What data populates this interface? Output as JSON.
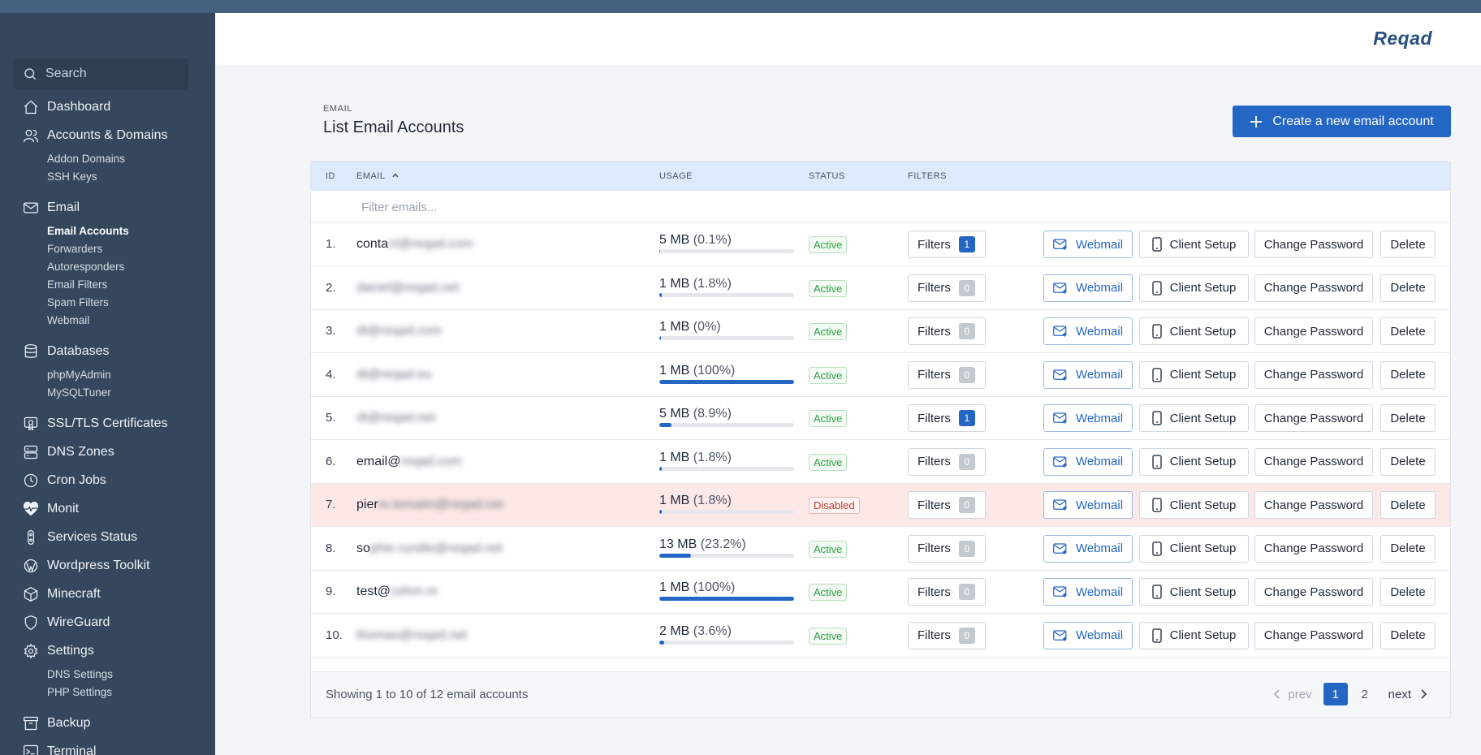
{
  "sidebar": {
    "search_placeholder": "Search",
    "items": [
      {
        "label": "Dashboard",
        "icon": "home-icon"
      },
      {
        "label": "Accounts & Domains",
        "icon": "users-icon",
        "sub": [
          "Addon Domains",
          "SSH Keys"
        ]
      },
      {
        "label": "Email",
        "icon": "mail-icon",
        "sub": [
          "Email Accounts",
          "Forwarders",
          "Autoresponders",
          "Email Filters",
          "Spam Filters",
          "Webmail"
        ],
        "active_sub": "Email Accounts"
      },
      {
        "label": "Databases",
        "icon": "database-icon",
        "sub": [
          "phpMyAdmin",
          "MySQLTuner"
        ]
      },
      {
        "label": "SSL/TLS Certificates",
        "icon": "certificate-icon"
      },
      {
        "label": "DNS Zones",
        "icon": "server-icon"
      },
      {
        "label": "Cron Jobs",
        "icon": "clock-icon"
      },
      {
        "label": "Monit",
        "icon": "heartbeat-icon"
      },
      {
        "label": "Services Status",
        "icon": "toggle-icon"
      },
      {
        "label": "Wordpress Toolkit",
        "icon": "wordpress-icon"
      },
      {
        "label": "Minecraft",
        "icon": "cube-icon"
      },
      {
        "label": "WireGuard",
        "icon": "shield-icon"
      },
      {
        "label": "Settings",
        "icon": "gear-icon",
        "sub": [
          "DNS Settings",
          "PHP Settings"
        ]
      },
      {
        "label": "Backup",
        "icon": "archive-icon"
      },
      {
        "label": "Terminal",
        "icon": "terminal-icon"
      }
    ]
  },
  "header": {
    "logo": "Reqad"
  },
  "page": {
    "breadcrumb": "EMAIL",
    "title": "List Email Accounts",
    "create_button": "Create a new email account"
  },
  "table": {
    "columns": {
      "id": "ID",
      "email": "EMAIL",
      "usage": "USAGE",
      "status": "STATUS",
      "filters": "FILTERS"
    },
    "filter_placeholder": "Filter emails...",
    "filters_label": "Filters",
    "actions": {
      "webmail": "Webmail",
      "client": "Client Setup",
      "password": "Change Password",
      "delete": "Delete"
    },
    "rows": [
      {
        "id": "1.",
        "email_visible": "conta",
        "email_blurred": "ct@reqad.com",
        "usage": "5 MB",
        "pct": "(0.1%)",
        "fill": 0.1,
        "status": "Active",
        "filters": "1"
      },
      {
        "id": "2.",
        "email_visible": "",
        "email_blurred": "daniel@reqad.net",
        "usage": "1 MB",
        "pct": "(1.8%)",
        "fill": 1.8,
        "status": "Active",
        "filters": "0"
      },
      {
        "id": "3.",
        "email_visible": "",
        "email_blurred": "dt@reqad.com",
        "usage": "1 MB",
        "pct": "(0%)",
        "fill": 0,
        "status": "Active",
        "filters": "0"
      },
      {
        "id": "4.",
        "email_visible": "",
        "email_blurred": "dt@reqad.eu",
        "usage": "1 MB",
        "pct": "(100%)",
        "fill": 100,
        "status": "Active",
        "filters": "0"
      },
      {
        "id": "5.",
        "email_visible": "",
        "email_blurred": "dt@reqad.net",
        "usage": "5 MB",
        "pct": "(8.9%)",
        "fill": 8.9,
        "status": "Active",
        "filters": "1"
      },
      {
        "id": "6.",
        "email_visible": "email@",
        "email_blurred": "reqad.com",
        "usage": "1 MB",
        "pct": "(1.8%)",
        "fill": 1.8,
        "status": "Active",
        "filters": "0"
      },
      {
        "id": "7.",
        "email_visible": "pier",
        "email_blurred": "re.lematin@reqad.net",
        "usage": "1 MB",
        "pct": "(1.8%)",
        "fill": 1.8,
        "status": "Disabled",
        "filters": "0"
      },
      {
        "id": "8.",
        "email_visible": "so",
        "email_blurred": "phie.rundle@reqad.net",
        "usage": "13 MB",
        "pct": "(23.2%)",
        "fill": 23.2,
        "status": "Active",
        "filters": "0"
      },
      {
        "id": "9.",
        "email_visible": "test@",
        "email_blurred": "cohm.re",
        "usage": "1 MB",
        "pct": "(100%)",
        "fill": 100,
        "status": "Active",
        "filters": "0"
      },
      {
        "id": "10.",
        "email_visible": "",
        "email_blurred": "thomas@reqad.net",
        "usage": "2 MB",
        "pct": "(3.6%)",
        "fill": 3.6,
        "status": "Active",
        "filters": "0"
      }
    ],
    "showing": "Showing 1 to 10 of 12 email accounts",
    "pager": {
      "prev": "prev",
      "pages": [
        "1",
        "2"
      ],
      "current": "1",
      "next": "next"
    }
  },
  "colors": {
    "accent": "#2466c4",
    "sidebar": "#35475c",
    "disabled_row": "#fde8e8"
  }
}
